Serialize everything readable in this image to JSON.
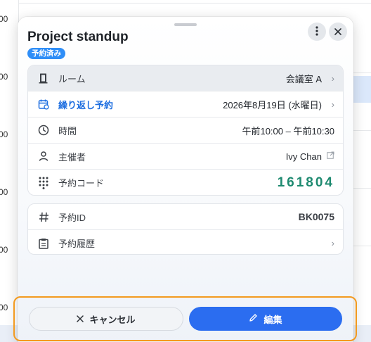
{
  "background": {
    "time_labels": [
      "00",
      "00",
      "00",
      "00",
      "00",
      "00"
    ]
  },
  "panel": {
    "title": "Project standup",
    "status_badge": "予約済み",
    "more_icon": "more-vertical-icon",
    "close_icon": "close-icon"
  },
  "details": {
    "room": {
      "label": "ルーム",
      "value": "会議室 A"
    },
    "recurrence": {
      "label": "繰り返し予約",
      "value": "2026年8月19日 (水曜日)"
    },
    "time": {
      "label": "時間",
      "value": "午前10:00 – 午前10:30"
    },
    "organizer": {
      "label": "主催者",
      "value": "Ivy Chan"
    },
    "code": {
      "label": "予約コード",
      "value": "161804"
    }
  },
  "meta": {
    "booking_id": {
      "label": "予約ID",
      "value": "BK0075"
    },
    "history": {
      "label": "予約履歴"
    }
  },
  "footer": {
    "cancel_label": "キャンセル",
    "edit_label": "編集"
  },
  "colors": {
    "accent": "#2b6df0",
    "badge": "#2f8ef7",
    "code": "#1e8a70",
    "highlight": "#f39a1f"
  }
}
